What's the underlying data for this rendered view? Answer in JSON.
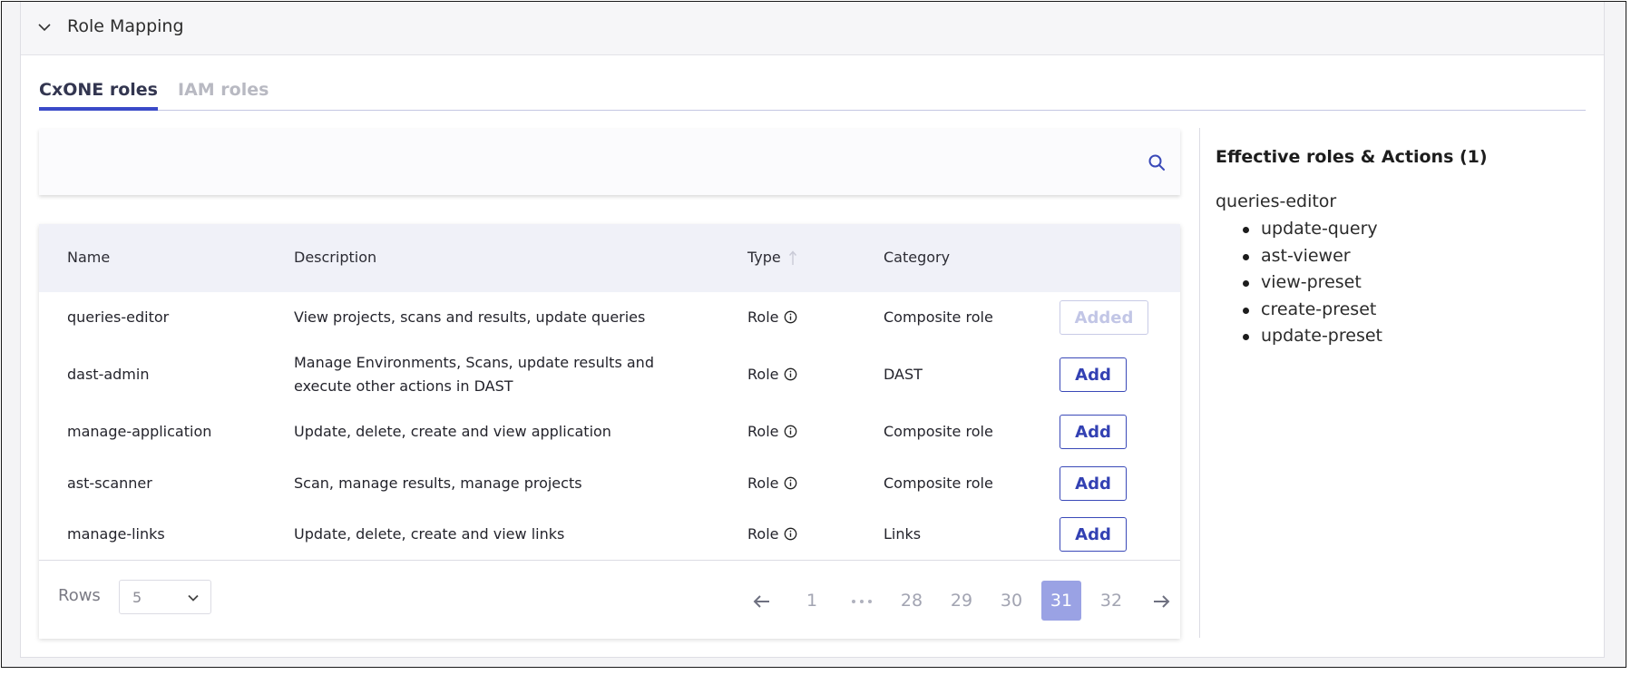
{
  "section": {
    "title": "Role Mapping"
  },
  "tabs": [
    {
      "label": "CxONE roles",
      "active": true
    },
    {
      "label": "IAM roles",
      "active": false
    }
  ],
  "search": {
    "value": "",
    "placeholder": "",
    "icon": "search-icon"
  },
  "table": {
    "headers": {
      "name": "Name",
      "description": "Description",
      "type": "Type",
      "category": "Category"
    },
    "rows": [
      {
        "name": "queries-editor",
        "description": "View projects, scans and results, update queries",
        "type": "Role",
        "category": "Composite role",
        "action": "Added"
      },
      {
        "name": "dast-admin",
        "description_line1": "Manage Environments, Scans, update results and",
        "description_line2": "execute other actions in DAST",
        "type": "Role",
        "category": "DAST",
        "action": "Add"
      },
      {
        "name": "manage-application",
        "description": "Update, delete, create and view application",
        "type": "Role",
        "category": "Composite role",
        "action": "Add"
      },
      {
        "name": "ast-scanner",
        "description": "Scan, manage results, manage projects",
        "type": "Role",
        "category": "Composite role",
        "action": "Add"
      },
      {
        "name": "manage-links",
        "description": "Update, delete, create and view links",
        "type": "Role",
        "category": "Links",
        "action": "Add"
      }
    ]
  },
  "pagination": {
    "rows_label": "Rows",
    "rows_value": "5",
    "pages": [
      "1",
      "28",
      "29",
      "30",
      "31",
      "32"
    ],
    "current_page": "31"
  },
  "effective": {
    "title": "Effective roles & Actions (1)",
    "role": "queries-editor",
    "actions": [
      "update-query",
      "ast-viewer",
      "view-preset",
      "create-preset",
      "update-preset"
    ]
  },
  "colors": {
    "accent": "#3a4ac8",
    "page_active": "#9aa2e4",
    "header_bg": "#f0f1f8"
  }
}
